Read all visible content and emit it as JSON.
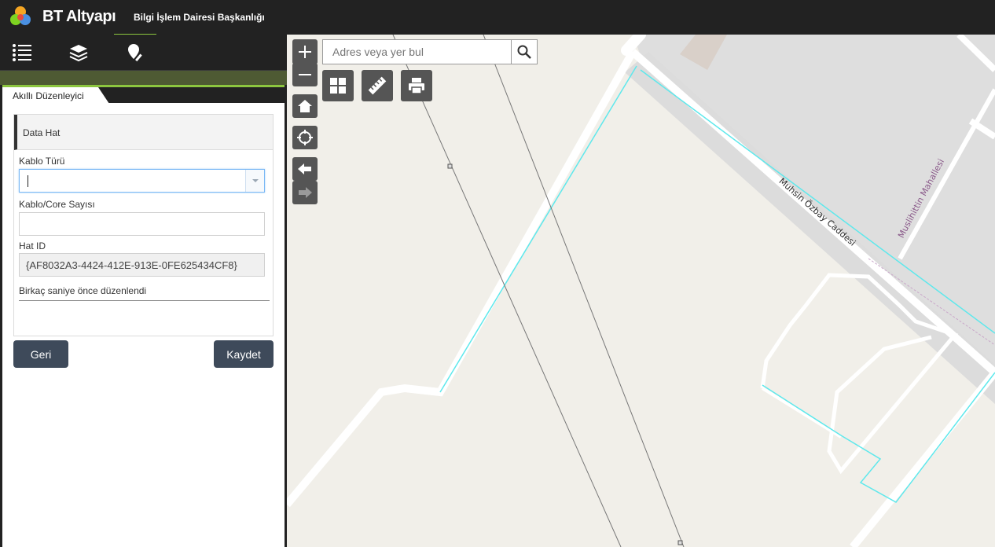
{
  "header": {
    "title": "BT Altyapı",
    "subtitle": "Bilgi İşlem Dairesi Başkanlığı"
  },
  "toolbar": {
    "icons": [
      "list-icon",
      "layers-icon",
      "edit-pin-icon"
    ]
  },
  "panel": {
    "tab_label": "Akıllı Düzenleyici",
    "form_title": "Data Hat",
    "fields": {
      "cable_type_label": "Kablo Türü",
      "cable_type_value": "",
      "core_count_label": "Kablo/Core Sayısı",
      "core_count_value": "",
      "line_id_label": "Hat ID",
      "line_id_value": "{AF8032A3-4424-412E-913E-0FE625434CF8}"
    },
    "status": "Birkaç saniye önce düzenlendi",
    "back_label": "Geri",
    "save_label": "Kaydet"
  },
  "map": {
    "search": {
      "placeholder": "Adres veya yer bul",
      "value": ""
    },
    "street_labels": {
      "main": "Muhsin Özbay Caddesi",
      "neighborhood": "Muslihittin Mahallesi"
    },
    "colors": {
      "background": "#f1efe9",
      "road": "#ffffff",
      "cable": "#5ee8ec",
      "block": "#dedede"
    }
  }
}
